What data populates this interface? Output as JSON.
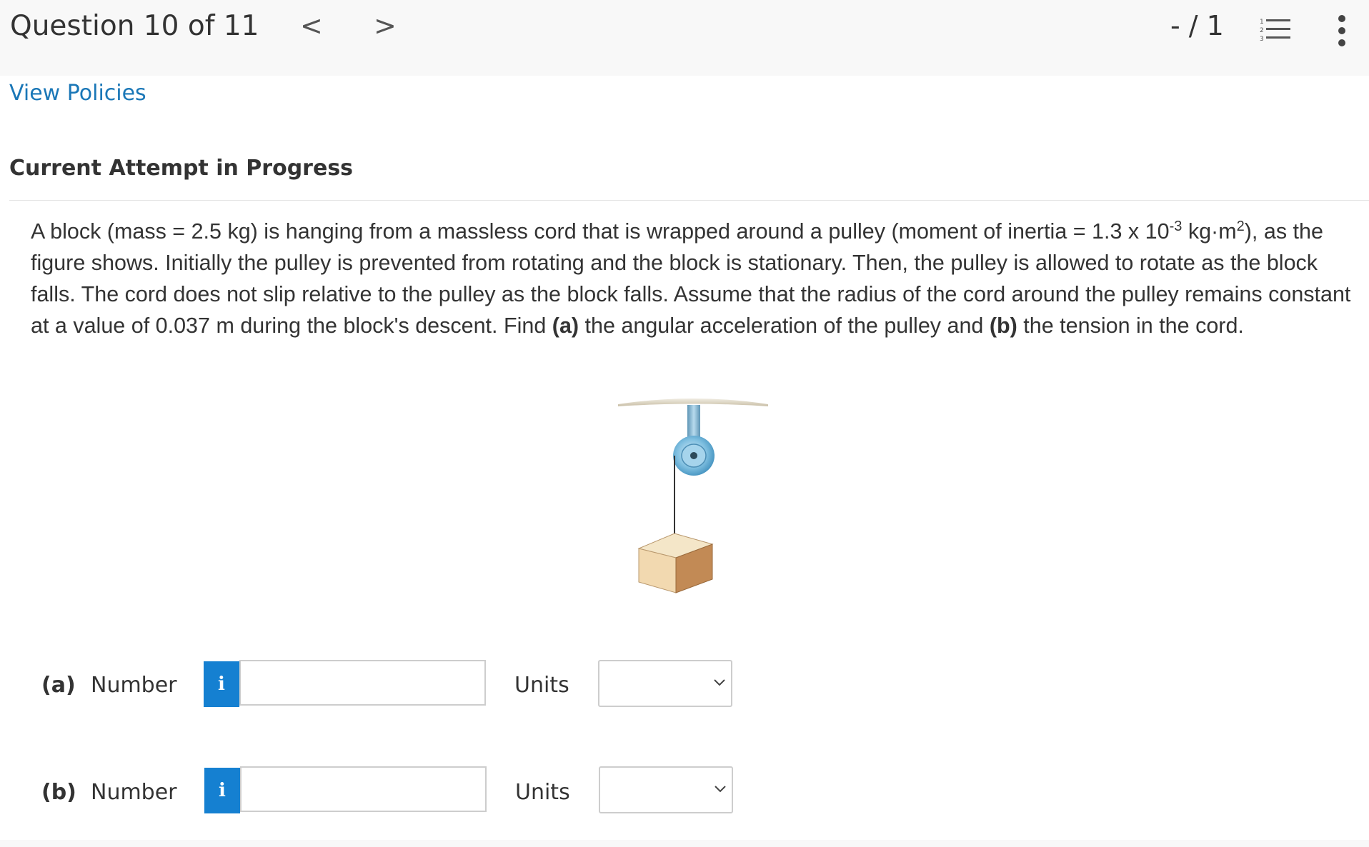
{
  "header": {
    "question_counter": "Question 10 of 11",
    "prev_label": "<",
    "next_label": ">",
    "score": "- / 1"
  },
  "links": {
    "view_policies": "View Policies"
  },
  "attempt": {
    "title": "Current Attempt in Progress"
  },
  "problem": {
    "t1": "A block (mass = 2.5 kg) is hanging from a massless cord that is wrapped around a pulley (moment of inertia = 1.3 x 10",
    "exp": "-3",
    "t2": " kg·m",
    "sq": "2",
    "t3": "), as the figure shows. Initially the pulley is prevented from rotating and the block is stationary. Then, the pulley is allowed to rotate as the block falls. The cord does not slip relative to the pulley as the block falls. Assume that the radius of the cord around the pulley remains constant at a value of 0.037 m during the block's descent. Find ",
    "a_bold": "(a)",
    "t4": " the angular acceleration of the pulley and ",
    "b_bold": "(b)",
    "t5": " the tension in the cord."
  },
  "answers": [
    {
      "part": "(a)",
      "number_label": "Number",
      "info": "i",
      "value": "",
      "units_label": "Units",
      "units_value": ""
    },
    {
      "part": "(b)",
      "number_label": "Number",
      "info": "i",
      "value": "",
      "units_label": "Units",
      "units_value": ""
    }
  ],
  "icons": {
    "prev": "chevron-left-icon",
    "next": "chevron-right-icon",
    "list": "numbered-list-icon",
    "more": "more-vertical-icon",
    "info": "info-icon",
    "dropdown": "chevron-down-icon"
  },
  "colors": {
    "link": "#1a77b7",
    "info_button": "#1580d1",
    "header_bg": "#f8f8f8",
    "text": "#333333",
    "pulley": "#6fb3d8",
    "block_front": "#f2d9b0",
    "block_side": "#c28a55"
  }
}
